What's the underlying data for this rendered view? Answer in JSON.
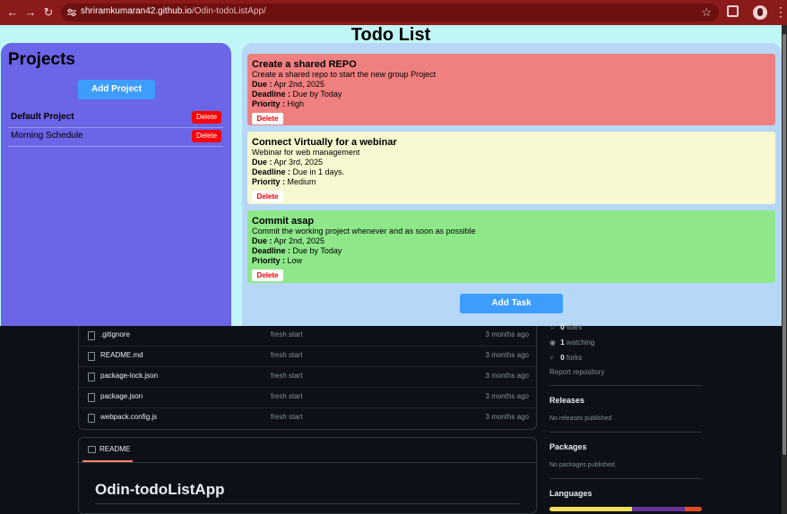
{
  "browser": {
    "url_host": "shriramkumaran42.github.io",
    "url_path": "/Odin-todoListApp/",
    "back_icon": "←",
    "forward_icon": "→",
    "reload_icon": "↻",
    "star_icon": "☆",
    "menu_icon": "⋮"
  },
  "app": {
    "title": "Todo List",
    "projects_heading": "Projects",
    "add_project_label": "Add Project",
    "projects": [
      {
        "name": "Default Project",
        "delete_label": "Delete",
        "active": true
      },
      {
        "name": "Morning Schedule",
        "delete_label": "Delete",
        "active": false
      }
    ],
    "tasks": [
      {
        "title": "Create a shared REPO",
        "description": "Create a shared repo to start the new group Project",
        "due_label": "Due :",
        "due": "Apr 2nd, 2025",
        "deadline_label": "Deadline :",
        "deadline": "Due by Today",
        "priority_label": "Priority :",
        "priority": "High",
        "delete_label": "Delete",
        "color": "#f08080"
      },
      {
        "title": "Connect Virtually for a webinar",
        "description": "Webinar for web management",
        "due_label": "Due :",
        "due": "Apr 3rd, 2025",
        "deadline_label": "Deadline :",
        "deadline": "Due in 1 days.",
        "priority_label": "Priority :",
        "priority": "Medium",
        "delete_label": "Delete",
        "color": "#f8f8d0"
      },
      {
        "title": "Commit asap",
        "description": "Commit the working project whenever and as soon as possible",
        "due_label": "Due :",
        "due": "Apr 2nd, 2025",
        "deadline_label": "Deadline :",
        "deadline": "Due by Today",
        "priority_label": "Priority :",
        "priority": "Low",
        "delete_label": "Delete",
        "color": "#8ee88a"
      }
    ],
    "add_task_label": "Add Task"
  },
  "github": {
    "files": [
      {
        "name": ".gitignore",
        "commit": "fresh start",
        "when": "3 months ago"
      },
      {
        "name": "README.md",
        "commit": "fresh start",
        "when": "3 months ago"
      },
      {
        "name": "package-lock.json",
        "commit": "fresh start",
        "when": "3 months ago"
      },
      {
        "name": "package.json",
        "commit": "fresh start",
        "when": "3 months ago"
      },
      {
        "name": "webpack.config.js",
        "commit": "fresh start",
        "when": "3 months ago"
      }
    ],
    "readme_tab": "README",
    "readme_title": "Odin-todoListApp",
    "stars": {
      "count": "0",
      "label": "stars"
    },
    "watching": {
      "count": "1",
      "label": "watching"
    },
    "forks": {
      "count": "0",
      "label": "forks"
    },
    "report": "Report repository",
    "releases_heading": "Releases",
    "releases_none": "No releases published",
    "packages_heading": "Packages",
    "packages_none": "No packages published",
    "languages_heading": "Languages",
    "language_colors": [
      "#f1e05a",
      "#663399",
      "#e34c26"
    ]
  }
}
